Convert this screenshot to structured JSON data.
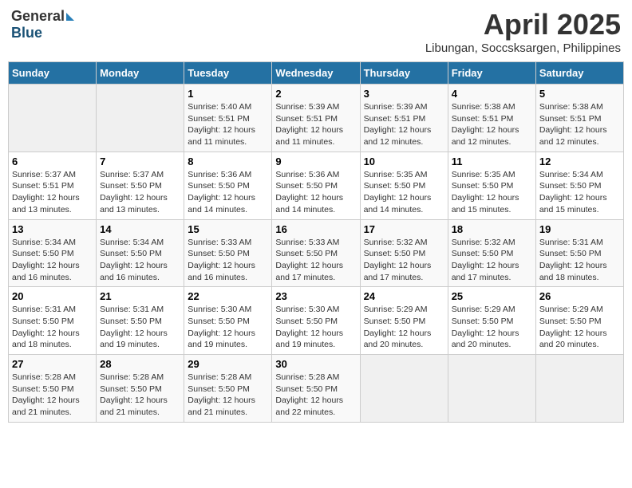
{
  "logo": {
    "general": "General",
    "blue": "Blue"
  },
  "title": {
    "month": "April 2025",
    "location": "Libungan, Soccsksargen, Philippines"
  },
  "days_of_week": [
    "Sunday",
    "Monday",
    "Tuesday",
    "Wednesday",
    "Thursday",
    "Friday",
    "Saturday"
  ],
  "weeks": [
    [
      {
        "day": "",
        "info": ""
      },
      {
        "day": "",
        "info": ""
      },
      {
        "day": "1",
        "info": "Sunrise: 5:40 AM\nSunset: 5:51 PM\nDaylight: 12 hours and 11 minutes."
      },
      {
        "day": "2",
        "info": "Sunrise: 5:39 AM\nSunset: 5:51 PM\nDaylight: 12 hours and 11 minutes."
      },
      {
        "day": "3",
        "info": "Sunrise: 5:39 AM\nSunset: 5:51 PM\nDaylight: 12 hours and 12 minutes."
      },
      {
        "day": "4",
        "info": "Sunrise: 5:38 AM\nSunset: 5:51 PM\nDaylight: 12 hours and 12 minutes."
      },
      {
        "day": "5",
        "info": "Sunrise: 5:38 AM\nSunset: 5:51 PM\nDaylight: 12 hours and 12 minutes."
      }
    ],
    [
      {
        "day": "6",
        "info": "Sunrise: 5:37 AM\nSunset: 5:51 PM\nDaylight: 12 hours and 13 minutes."
      },
      {
        "day": "7",
        "info": "Sunrise: 5:37 AM\nSunset: 5:50 PM\nDaylight: 12 hours and 13 minutes."
      },
      {
        "day": "8",
        "info": "Sunrise: 5:36 AM\nSunset: 5:50 PM\nDaylight: 12 hours and 14 minutes."
      },
      {
        "day": "9",
        "info": "Sunrise: 5:36 AM\nSunset: 5:50 PM\nDaylight: 12 hours and 14 minutes."
      },
      {
        "day": "10",
        "info": "Sunrise: 5:35 AM\nSunset: 5:50 PM\nDaylight: 12 hours and 14 minutes."
      },
      {
        "day": "11",
        "info": "Sunrise: 5:35 AM\nSunset: 5:50 PM\nDaylight: 12 hours and 15 minutes."
      },
      {
        "day": "12",
        "info": "Sunrise: 5:34 AM\nSunset: 5:50 PM\nDaylight: 12 hours and 15 minutes."
      }
    ],
    [
      {
        "day": "13",
        "info": "Sunrise: 5:34 AM\nSunset: 5:50 PM\nDaylight: 12 hours and 16 minutes."
      },
      {
        "day": "14",
        "info": "Sunrise: 5:34 AM\nSunset: 5:50 PM\nDaylight: 12 hours and 16 minutes."
      },
      {
        "day": "15",
        "info": "Sunrise: 5:33 AM\nSunset: 5:50 PM\nDaylight: 12 hours and 16 minutes."
      },
      {
        "day": "16",
        "info": "Sunrise: 5:33 AM\nSunset: 5:50 PM\nDaylight: 12 hours and 17 minutes."
      },
      {
        "day": "17",
        "info": "Sunrise: 5:32 AM\nSunset: 5:50 PM\nDaylight: 12 hours and 17 minutes."
      },
      {
        "day": "18",
        "info": "Sunrise: 5:32 AM\nSunset: 5:50 PM\nDaylight: 12 hours and 17 minutes."
      },
      {
        "day": "19",
        "info": "Sunrise: 5:31 AM\nSunset: 5:50 PM\nDaylight: 12 hours and 18 minutes."
      }
    ],
    [
      {
        "day": "20",
        "info": "Sunrise: 5:31 AM\nSunset: 5:50 PM\nDaylight: 12 hours and 18 minutes."
      },
      {
        "day": "21",
        "info": "Sunrise: 5:31 AM\nSunset: 5:50 PM\nDaylight: 12 hours and 19 minutes."
      },
      {
        "day": "22",
        "info": "Sunrise: 5:30 AM\nSunset: 5:50 PM\nDaylight: 12 hours and 19 minutes."
      },
      {
        "day": "23",
        "info": "Sunrise: 5:30 AM\nSunset: 5:50 PM\nDaylight: 12 hours and 19 minutes."
      },
      {
        "day": "24",
        "info": "Sunrise: 5:29 AM\nSunset: 5:50 PM\nDaylight: 12 hours and 20 minutes."
      },
      {
        "day": "25",
        "info": "Sunrise: 5:29 AM\nSunset: 5:50 PM\nDaylight: 12 hours and 20 minutes."
      },
      {
        "day": "26",
        "info": "Sunrise: 5:29 AM\nSunset: 5:50 PM\nDaylight: 12 hours and 20 minutes."
      }
    ],
    [
      {
        "day": "27",
        "info": "Sunrise: 5:28 AM\nSunset: 5:50 PM\nDaylight: 12 hours and 21 minutes."
      },
      {
        "day": "28",
        "info": "Sunrise: 5:28 AM\nSunset: 5:50 PM\nDaylight: 12 hours and 21 minutes."
      },
      {
        "day": "29",
        "info": "Sunrise: 5:28 AM\nSunset: 5:50 PM\nDaylight: 12 hours and 21 minutes."
      },
      {
        "day": "30",
        "info": "Sunrise: 5:28 AM\nSunset: 5:50 PM\nDaylight: 12 hours and 22 minutes."
      },
      {
        "day": "",
        "info": ""
      },
      {
        "day": "",
        "info": ""
      },
      {
        "day": "",
        "info": ""
      }
    ]
  ]
}
